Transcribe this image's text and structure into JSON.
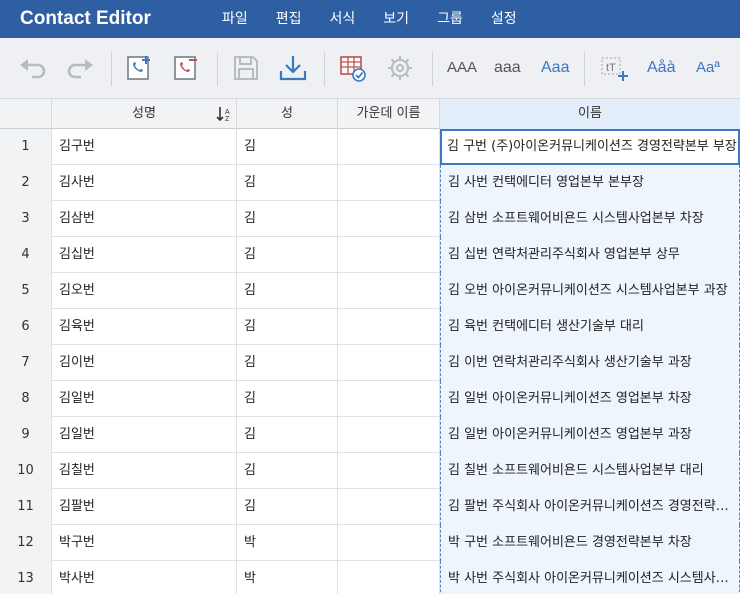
{
  "app": {
    "title": "Contact Editor"
  },
  "menu": [
    {
      "label": "파일"
    },
    {
      "label": "편집"
    },
    {
      "label": "서식"
    },
    {
      "label": "보기"
    },
    {
      "label": "그룹"
    },
    {
      "label": "설정"
    }
  ],
  "toolbar": {
    "upper_label": "AAA",
    "lower_label": "aaa",
    "title_label": "Aaa",
    "text_mix_label": "Aåà",
    "text_style_label": "Aaª",
    "colors": {
      "accent": "#2e5fa3",
      "icon_blue": "#3a78c2",
      "icon_red": "#c0504d",
      "icon_gray": "#b8bcc2"
    }
  },
  "grid": {
    "columns": [
      {
        "label": ""
      },
      {
        "label": "성명"
      },
      {
        "label": "성"
      },
      {
        "label": "가운데 이름"
      },
      {
        "label": "이름"
      }
    ],
    "rows": [
      {
        "num": "1",
        "name": "김구번",
        "last": "김",
        "middle": "",
        "full": "김 구번 (주)아이온커뮤니케이션즈 경영전략본부 부장"
      },
      {
        "num": "2",
        "name": "김사번",
        "last": "김",
        "middle": "",
        "full": "김 사번 컨택에디터 영업본부 본부장"
      },
      {
        "num": "3",
        "name": "김삼번",
        "last": "김",
        "middle": "",
        "full": "김 삼번 소프트웨어비욘드 시스템사업본부 차장"
      },
      {
        "num": "4",
        "name": "김십번",
        "last": "김",
        "middle": "",
        "full": "김 십번 연락처관리주식회사 영업본부 상무"
      },
      {
        "num": "5",
        "name": "김오번",
        "last": "김",
        "middle": "",
        "full": "김 오번 아이온커뮤니케이션즈 시스템사업본부 과장"
      },
      {
        "num": "6",
        "name": "김육번",
        "last": "김",
        "middle": "",
        "full": "김 육번 컨택에디터 생산기술부 대리"
      },
      {
        "num": "7",
        "name": "김이번",
        "last": "김",
        "middle": "",
        "full": "김 이번 연락처관리주식회사 생산기술부 과장"
      },
      {
        "num": "8",
        "name": "김일번",
        "last": "김",
        "middle": "",
        "full": "김 일번 아이온커뮤니케이션즈 영업본부 차장"
      },
      {
        "num": "9",
        "name": "김일번",
        "last": "김",
        "middle": "",
        "full": "김 일번 아이온커뮤니케이션즈 영업본부 과장"
      },
      {
        "num": "10",
        "name": "김칠번",
        "last": "김",
        "middle": "",
        "full": "김 칠번 소프트웨어비욘드 시스템사업본부 대리"
      },
      {
        "num": "11",
        "name": "김팔번",
        "last": "김",
        "middle": "",
        "full": "김 팔번 주식회사 아이온커뮤니케이션즈 경영전략본…"
      },
      {
        "num": "12",
        "name": "박구번",
        "last": "박",
        "middle": "",
        "full": "박 구번 소프트웨어비욘드 경영전략본부 차장"
      },
      {
        "num": "13",
        "name": "박사번",
        "last": "박",
        "middle": "",
        "full": "박 사번 주식회사 아이온커뮤니케이션즈 시스템사업…"
      }
    ]
  }
}
